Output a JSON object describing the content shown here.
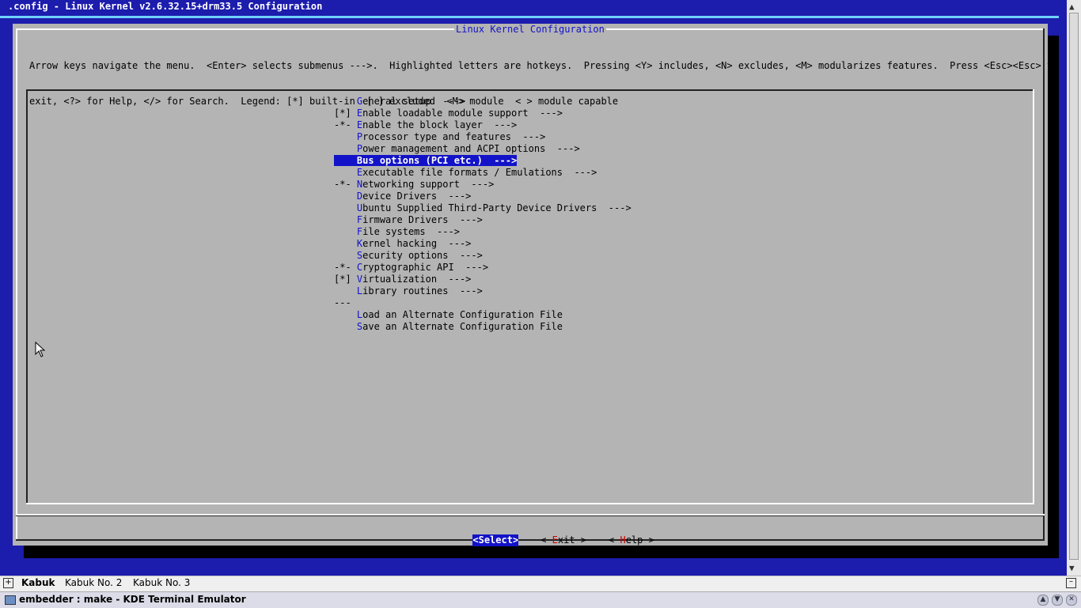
{
  "terminal": {
    "title": ".config - Linux Kernel v2.6.32.15+drm33.5 Configuration"
  },
  "dialog": {
    "title": "Linux Kernel Configuration",
    "instructions_line1": "Arrow keys navigate the menu.  <Enter> selects submenus --->.  Highlighted letters are hotkeys.  Pressing <Y> includes, <N> excludes, <M> modularizes features.  Press <Esc><Esc> to",
    "instructions_line2": "exit, <?> for Help, </> for Search.  Legend: [*] built-in  [ ] excluded  <M> module  < > module capable"
  },
  "menu": {
    "items": [
      {
        "prefix": "    ",
        "hot": "G",
        "rest": "eneral setup  --->"
      },
      {
        "prefix": "[*] ",
        "hot": "E",
        "rest": "nable loadable module support  --->"
      },
      {
        "prefix": "-*- ",
        "hot": "E",
        "rest": "nable the block layer  --->"
      },
      {
        "prefix": "    ",
        "hot": "P",
        "rest": "rocessor type and features  --->"
      },
      {
        "prefix": "    ",
        "hot": "P",
        "rest": "ower management and ACPI options  --->"
      },
      {
        "prefix": "    ",
        "hot": "B",
        "rest": "us options (PCI etc.)  --->"
      },
      {
        "prefix": "    ",
        "hot": "E",
        "rest": "xecutable file formats / Emulations  --->"
      },
      {
        "prefix": "-*- ",
        "hot": "N",
        "rest": "etworking support  --->"
      },
      {
        "prefix": "    ",
        "hot": "D",
        "rest": "evice Drivers  --->"
      },
      {
        "prefix": "    ",
        "hot": "U",
        "rest": "buntu Supplied Third-Party Device Drivers  --->"
      },
      {
        "prefix": "    ",
        "hot": "F",
        "rest": "irmware Drivers  --->"
      },
      {
        "prefix": "    ",
        "hot": "F",
        "rest": "ile systems  --->"
      },
      {
        "prefix": "    ",
        "hot": "K",
        "rest": "ernel hacking  --->"
      },
      {
        "prefix": "    ",
        "hot": "S",
        "rest": "ecurity options  --->"
      },
      {
        "prefix": "-*- ",
        "hot": "C",
        "rest": "ryptographic API  --->"
      },
      {
        "prefix": "[*] ",
        "hot": "V",
        "rest": "irtualization  --->"
      },
      {
        "prefix": "    ",
        "hot": "L",
        "rest": "ibrary routines  --->"
      },
      {
        "prefix": "--- ",
        "hot": "",
        "rest": ""
      },
      {
        "prefix": "    ",
        "hot": "L",
        "rest": "oad an Alternate Configuration File"
      },
      {
        "prefix": "    ",
        "hot": "S",
        "rest": "ave an Alternate Configuration File"
      }
    ],
    "selected_index": 5
  },
  "buttons": {
    "select": {
      "open": "<",
      "hot": "S",
      "rest": "elect",
      "close": ">"
    },
    "exit": {
      "open": "< ",
      "hot": "E",
      "rest": "xit",
      "close": " >"
    },
    "help": {
      "open": "< ",
      "hot": "H",
      "rest": "elp",
      "close": " >"
    }
  },
  "tabs": {
    "items": [
      "Kabuk",
      "Kabuk No. 2",
      "Kabuk No. 3"
    ],
    "active_index": 0
  },
  "taskbar": {
    "window_title": "embedder : make - KDE Terminal Emulator"
  },
  "colors": {
    "terminal_bg": "#1c1cad",
    "dialog_bg": "#b4b4b4",
    "highlight": "#1212c8",
    "hotkey": "#1212c8"
  }
}
